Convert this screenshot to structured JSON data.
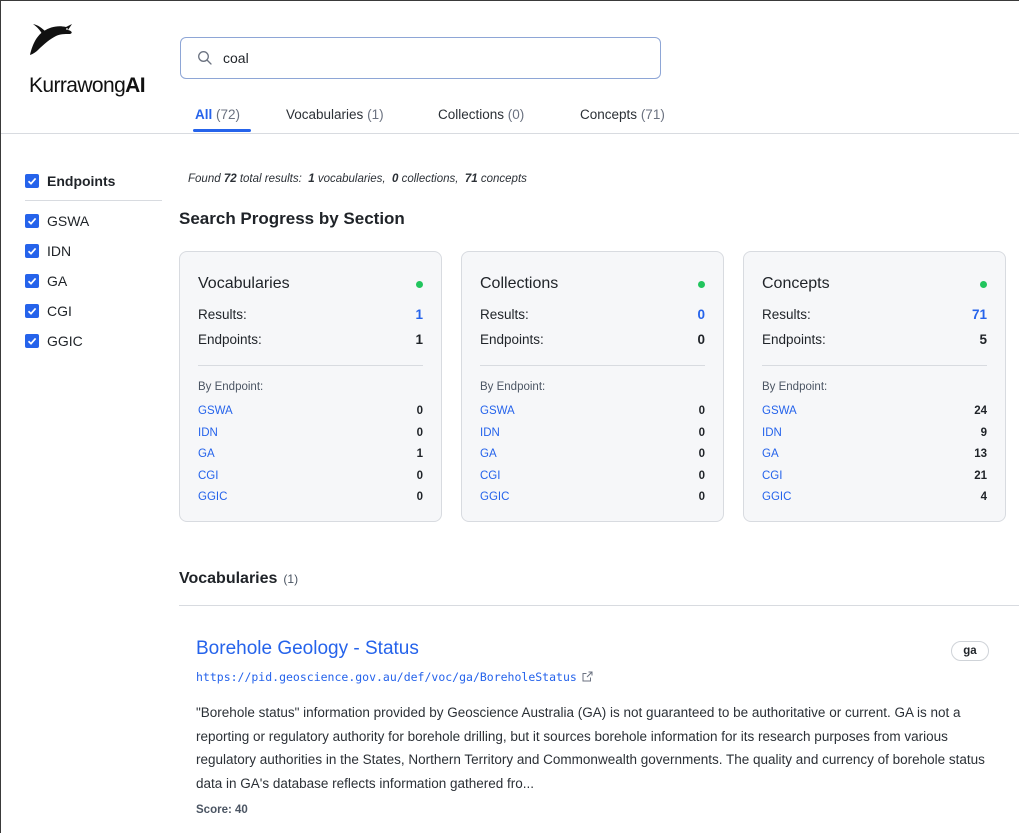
{
  "app": {
    "logo_text_regular": "Kurrawong",
    "logo_text_bold": "AI"
  },
  "search": {
    "value": "coal",
    "placeholder": ""
  },
  "tabs": [
    {
      "label": "All",
      "count": "(72)",
      "active": true
    },
    {
      "label": "Vocabularies",
      "count": "(1)",
      "active": false
    },
    {
      "label": "Collections",
      "count": "(0)",
      "active": false
    },
    {
      "label": "Concepts",
      "count": "(71)",
      "active": false
    }
  ],
  "sidebar": {
    "header": "Endpoints",
    "items": [
      {
        "label": "GSWA",
        "checked": true
      },
      {
        "label": "IDN",
        "checked": true
      },
      {
        "label": "GA",
        "checked": true
      },
      {
        "label": "CGI",
        "checked": true
      },
      {
        "label": "GGIC",
        "checked": true
      }
    ]
  },
  "summary": {
    "found_prefix": "Found",
    "total": "72",
    "total_suffix": "total results:",
    "vocab_count": "1",
    "vocab_label": "vocabularies,",
    "coll_count": "0",
    "coll_label": "collections,",
    "concept_count": "71",
    "concept_label": "concepts"
  },
  "progress": {
    "heading": "Search Progress by Section",
    "results_label": "Results:",
    "endpoints_label": "Endpoints:",
    "by_endpoint_label": "By Endpoint:",
    "cards": [
      {
        "title": "Vocabularies",
        "results": "1",
        "endpoints": "1",
        "by_endpoint": [
          {
            "name": "GSWA",
            "count": "0"
          },
          {
            "name": "IDN",
            "count": "0"
          },
          {
            "name": "GA",
            "count": "1"
          },
          {
            "name": "CGI",
            "count": "0"
          },
          {
            "name": "GGIC",
            "count": "0"
          }
        ]
      },
      {
        "title": "Collections",
        "results": "0",
        "endpoints": "0",
        "by_endpoint": [
          {
            "name": "GSWA",
            "count": "0"
          },
          {
            "name": "IDN",
            "count": "0"
          },
          {
            "name": "GA",
            "count": "0"
          },
          {
            "name": "CGI",
            "count": "0"
          },
          {
            "name": "GGIC",
            "count": "0"
          }
        ]
      },
      {
        "title": "Concepts",
        "results": "71",
        "endpoints": "5",
        "by_endpoint": [
          {
            "name": "GSWA",
            "count": "24"
          },
          {
            "name": "IDN",
            "count": "9"
          },
          {
            "name": "GA",
            "count": "13"
          },
          {
            "name": "CGI",
            "count": "21"
          },
          {
            "name": "GGIC",
            "count": "4"
          }
        ]
      }
    ]
  },
  "vocabularies_section": {
    "heading": "Vocabularies",
    "count": "(1)",
    "results": [
      {
        "title": "Borehole Geology - Status",
        "url": "https://pid.geoscience.gov.au/def/voc/ga/BoreholeStatus",
        "badge": "ga",
        "description": "\"Borehole status\" information provided by Geoscience Australia (GA) is not guaranteed to be authoritative or current. GA is not a reporting or regulatory authority for borehole drilling, but it sources borehole information for its research purposes from various regulatory authorities in the States, Northern Territory and Commonwealth governments. The quality and currency of borehole status data in GA's database reflects information gathered fro...",
        "score": "Score: 40"
      }
    ]
  },
  "colors": {
    "accent": "#2563eb",
    "status_ok": "#22c55e",
    "card_bg": "#f6f7f9",
    "border": "#d8dbe0"
  }
}
